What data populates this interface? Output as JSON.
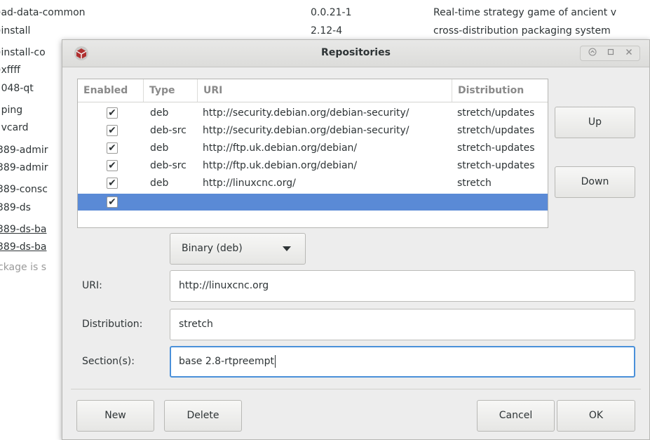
{
  "background_list": {
    "rows": [
      {
        "name": ")ad-data-common",
        "version": "0.0.21-1",
        "desc": "Real-time strategy game of ancient v"
      },
      {
        "name": ")install",
        "version": "2.12-4",
        "desc": "cross-distribution packaging system"
      },
      {
        "name": ")install-co",
        "version": "",
        "desc": ""
      },
      {
        "name": ")xffff",
        "version": "",
        "desc": ""
      },
      {
        "name": "!048-qt",
        "version": "",
        "desc": ""
      },
      {
        "name": "!ping",
        "version": "",
        "desc": ""
      },
      {
        "name": "!vcard",
        "version": "",
        "desc": ""
      },
      {
        "name": "389-admir",
        "version": "",
        "desc": ""
      },
      {
        "name": "389-admir",
        "version": "",
        "desc": ""
      },
      {
        "name": "389-consc",
        "version": "",
        "desc": ""
      },
      {
        "name": "389-ds",
        "version": "",
        "desc": ""
      },
      {
        "name": "389-ds-ba",
        "version": "",
        "desc": ""
      },
      {
        "name": "389-ds-ba",
        "version": "",
        "desc": ""
      }
    ],
    "status_text": "ckage is s"
  },
  "dialog": {
    "title": "Repositories",
    "icon": "software-package-icon",
    "window_controls": [
      "up-icon",
      "maximize-icon",
      "close-icon"
    ],
    "table": {
      "headers": [
        "Enabled",
        "Type",
        "URI",
        "Distribution"
      ],
      "rows": [
        {
          "enabled": true,
          "type": "deb",
          "uri": "http://security.debian.org/debian-security/",
          "dist": "stretch/updates"
        },
        {
          "enabled": true,
          "type": "deb-src",
          "uri": "http://security.debian.org/debian-security/",
          "dist": "stretch/updates"
        },
        {
          "enabled": true,
          "type": "deb",
          "uri": "http://ftp.uk.debian.org/debian/",
          "dist": "stretch-updates"
        },
        {
          "enabled": true,
          "type": "deb-src",
          "uri": "http://ftp.uk.debian.org/debian/",
          "dist": "stretch-updates"
        },
        {
          "enabled": true,
          "type": "deb",
          "uri": "http://linuxcnc.org/",
          "dist": "stretch"
        },
        {
          "enabled": true,
          "type": "",
          "uri": "",
          "dist": ""
        }
      ],
      "check_glyph": "✔"
    },
    "up_label": "Up",
    "down_label": "Down",
    "type_combo": "Binary (deb)",
    "uri_label": "URI:",
    "uri_value": "http://linuxcnc.org",
    "distribution_label": "Distribution:",
    "distribution_value": "stretch",
    "sections_label": "Section(s):",
    "sections_value": "base 2.8-rtpreempt",
    "new_label": "New",
    "delete_label": "Delete",
    "cancel_label": "Cancel",
    "ok_label": "OK",
    "colors": {
      "selection": "#5a8ad6",
      "focus": "#4a90d9"
    }
  }
}
